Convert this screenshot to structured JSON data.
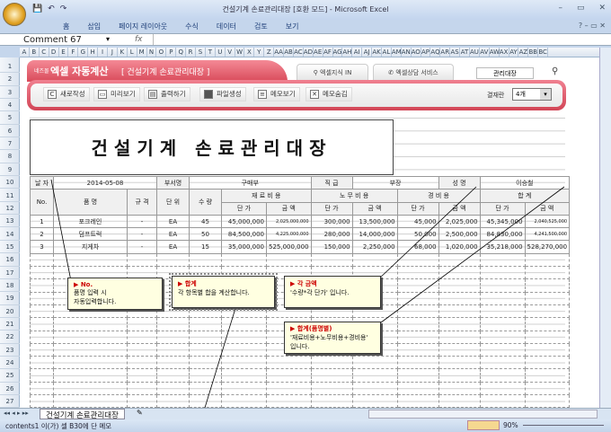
{
  "window": {
    "title": "건설기계 손료관리대장 [호환 모드] - Microsoft Excel"
  },
  "ribbon": {
    "tabs": [
      "홈",
      "삽입",
      "페이지 레이아웃",
      "수식",
      "데이터",
      "검토",
      "보기"
    ]
  },
  "formula_bar": {
    "name_box": "Comment 67",
    "fx": "fx",
    "value": ""
  },
  "columns": [
    "A",
    "B",
    "C",
    "D",
    "E",
    "F",
    "G",
    "H",
    "I",
    "J",
    "K",
    "L",
    "M",
    "N",
    "O",
    "P",
    "Q",
    "R",
    "S",
    "T",
    "U",
    "V",
    "W",
    "X",
    "Y",
    "Z",
    "AA",
    "AB",
    "AC",
    "AD",
    "AE",
    "AF",
    "AG",
    "AH",
    "AI",
    "AJ",
    "AK",
    "AL",
    "AM",
    "AN",
    "AO",
    "AP",
    "AQ",
    "AR",
    "AS",
    "AT",
    "AU",
    "AV",
    "AW",
    "AX",
    "AY",
    "AZ",
    "BB",
    "BC"
  ],
  "rows": [
    "1",
    "2",
    "3",
    "4",
    "5",
    "6",
    "7",
    "8",
    "9",
    "10",
    "11",
    "12",
    "13",
    "14",
    "15",
    "16",
    "17",
    "18",
    "19",
    "20",
    "21",
    "22",
    "23",
    "24",
    "25",
    "26",
    "27"
  ],
  "banner": {
    "brand_small": "네즈몰",
    "brand": "엑셀 자동계산",
    "subtitle": "[ 건설기계 손료관리대장 ]",
    "link1": "엑셀지식 IN",
    "link2": "엑셀상담 서비스",
    "search_value": "관리대장",
    "buttons": [
      {
        "label": "새로작성",
        "icon": "refresh-icon"
      },
      {
        "label": "미리보기",
        "icon": "preview-icon"
      },
      {
        "label": "출력하기",
        "icon": "print-icon"
      },
      {
        "label": "파일생성",
        "icon": "folder-icon"
      },
      {
        "label": "메모보기",
        "icon": "memo-icon"
      },
      {
        "label": "메모숨김",
        "icon": "memo-hide-icon"
      }
    ],
    "rows_label": "결재란",
    "rows_value": "4개"
  },
  "doc": {
    "title": "건설기계 손료관리대장",
    "info": {
      "date_label": "날 자",
      "date": "2014-05-08",
      "dept_label": "부서명",
      "dept": "구매부",
      "rank_label": "직 급",
      "rank": "부장",
      "name_label": "성 명",
      "name": "이승철"
    },
    "headers": {
      "no": "No.",
      "item": "품 명",
      "spec": "규 격",
      "unit": "단 위",
      "qty": "수 량",
      "material": "재 료 비 용",
      "labor": "노 무 비 용",
      "expense": "경 비 용",
      "total": "합 계",
      "unit_price": "단 가",
      "amount": "금 액"
    },
    "rows": [
      [
        "1",
        "포크레인",
        "-",
        "EA",
        "45",
        "45,000,000",
        "2,025,000,000",
        "300,000",
        "13,500,000",
        "45,000",
        "2,025,000",
        "45,345,000",
        "2,040,525,000"
      ],
      [
        "2",
        "덤프트럭",
        "-",
        "EA",
        "50",
        "84,500,000",
        "4,225,000,000",
        "280,000",
        "14,000,000",
        "50,000",
        "2,500,000",
        "84,830,000",
        "4,241,500,000"
      ],
      [
        "3",
        "지게차",
        "-",
        "EA",
        "15",
        "35,000,000",
        "525,000,000",
        "150,000",
        "2,250,000",
        "68,000",
        "1,020,000",
        "35,218,000",
        "528,270,000"
      ]
    ]
  },
  "comments": [
    {
      "title": "▶ No.",
      "text1": "품명 입력 시",
      "text2": "자동입력합니다."
    },
    {
      "title": "▶ 합계",
      "text1": "각 항목별 합을 계산합니다.",
      "text2": ""
    },
    {
      "title": "▶ 각 금액",
      "text1": "'수량*각 단가' 입니다.",
      "text2": ""
    },
    {
      "title": "▶ 합계(품명별)",
      "text1": "'재료비용+노무비용+경비용'",
      "text2": "입니다."
    }
  ],
  "sheet_tabs": [
    "건설기계 손료관리대장"
  ],
  "status": {
    "text": "contents1 이(가) 셀 B30에 단 메모",
    "zoom": "90%"
  }
}
